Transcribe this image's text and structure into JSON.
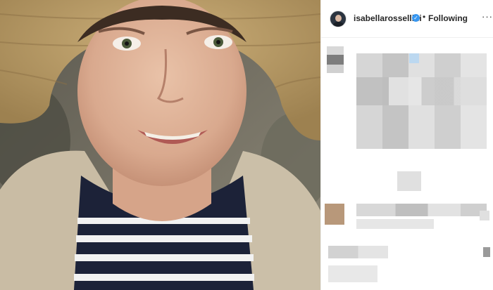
{
  "post": {
    "photo_alt": "Smiling woman in a straw hat wearing a striped shirt and fleece jacket"
  },
  "header": {
    "username": "isabellarossellini",
    "verified_badge": "✓",
    "separator": "•",
    "follow_status": "Following",
    "more_glyph": "···"
  },
  "comments": {
    "state": "pixelated"
  },
  "colors": {
    "accent": "#3897f0",
    "text": "#262626",
    "divider": "#efefef"
  },
  "icons": [
    "avatar",
    "verified-badge-icon",
    "more-options-icon"
  ]
}
